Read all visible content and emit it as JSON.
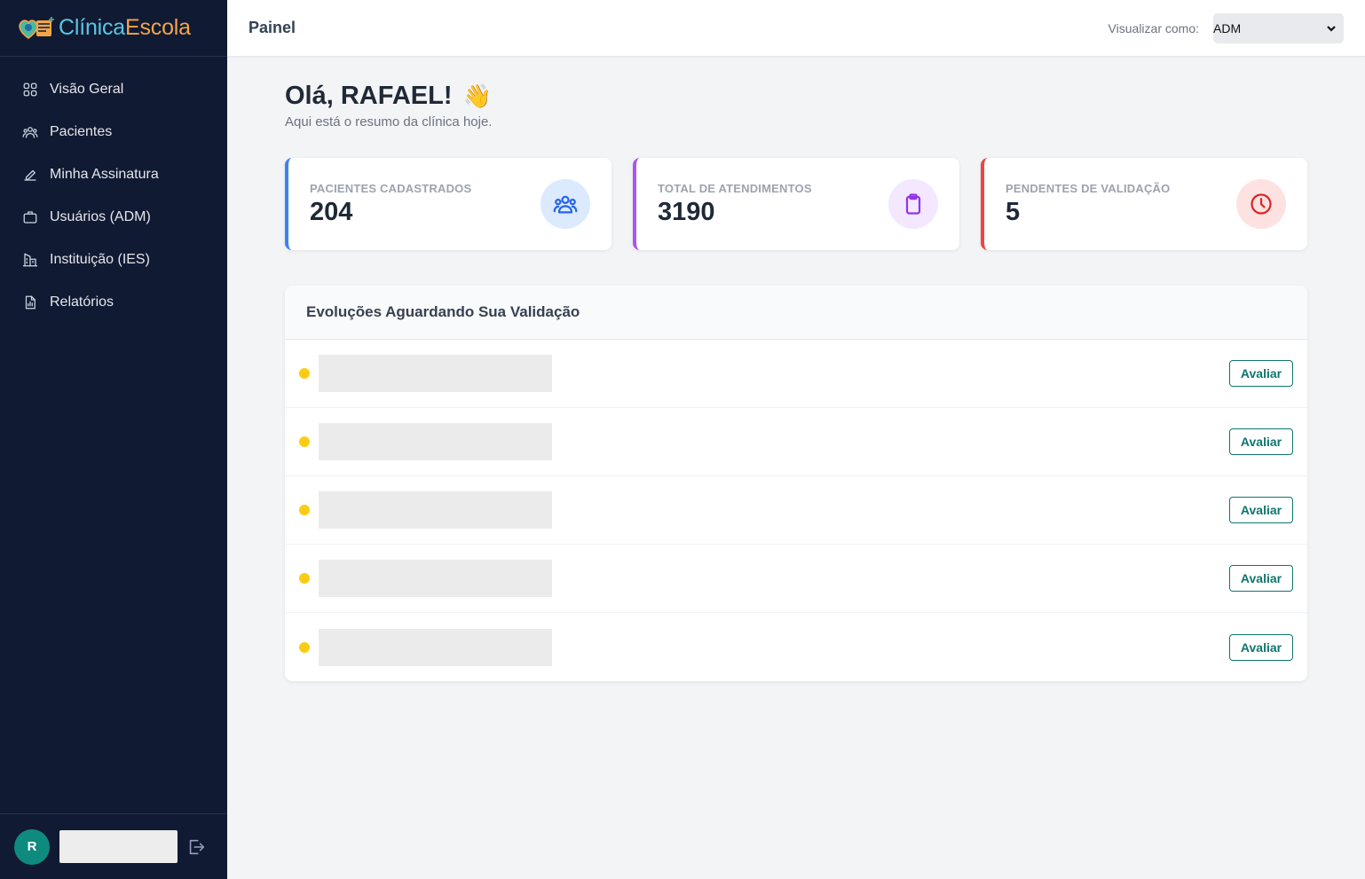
{
  "brand": {
    "part1": "Clínica",
    "part2": "Escola"
  },
  "sidebar": {
    "items": [
      {
        "label": "Visão Geral",
        "icon": "grid-icon"
      },
      {
        "label": "Pacientes",
        "icon": "users-icon"
      },
      {
        "label": "Minha Assinatura",
        "icon": "pen-icon"
      },
      {
        "label": "Usuários (ADM)",
        "icon": "briefcase-icon"
      },
      {
        "label": "Instituição (IES)",
        "icon": "building-icon"
      },
      {
        "label": "Relatórios",
        "icon": "report-icon"
      }
    ],
    "user": {
      "initial": "R"
    }
  },
  "topbar": {
    "title": "Painel",
    "view_as_label": "Visualizar como:",
    "view_as_value": "ADM"
  },
  "main": {
    "greeting": "Olá, RAFAEL!",
    "greeting_emoji": "👋",
    "subtitle": "Aqui está o resumo da clínica hoje.",
    "cards": [
      {
        "label": "PACIENTES CADASTRADOS",
        "value": "204",
        "icon": "users-icon",
        "accent": "#3b82f6"
      },
      {
        "label": "TOTAL DE ATENDIMENTOS",
        "value": "3190",
        "icon": "clipboard-icon",
        "accent": "#a855f7"
      },
      {
        "label": "PENDENTES DE VALIDAÇÃO",
        "value": "5",
        "icon": "clock-icon",
        "accent": "#ef4444"
      }
    ],
    "panel": {
      "title": "Evoluções Aguardando Sua Validação",
      "rows": [
        {
          "action": "Avaliar"
        },
        {
          "action": "Avaliar"
        },
        {
          "action": "Avaliar"
        },
        {
          "action": "Avaliar"
        },
        {
          "action": "Avaliar"
        }
      ]
    }
  },
  "colors": {
    "sidebar_bg": "#111a33",
    "accent_teal": "#0f766e",
    "pending_dot": "#facc15"
  }
}
